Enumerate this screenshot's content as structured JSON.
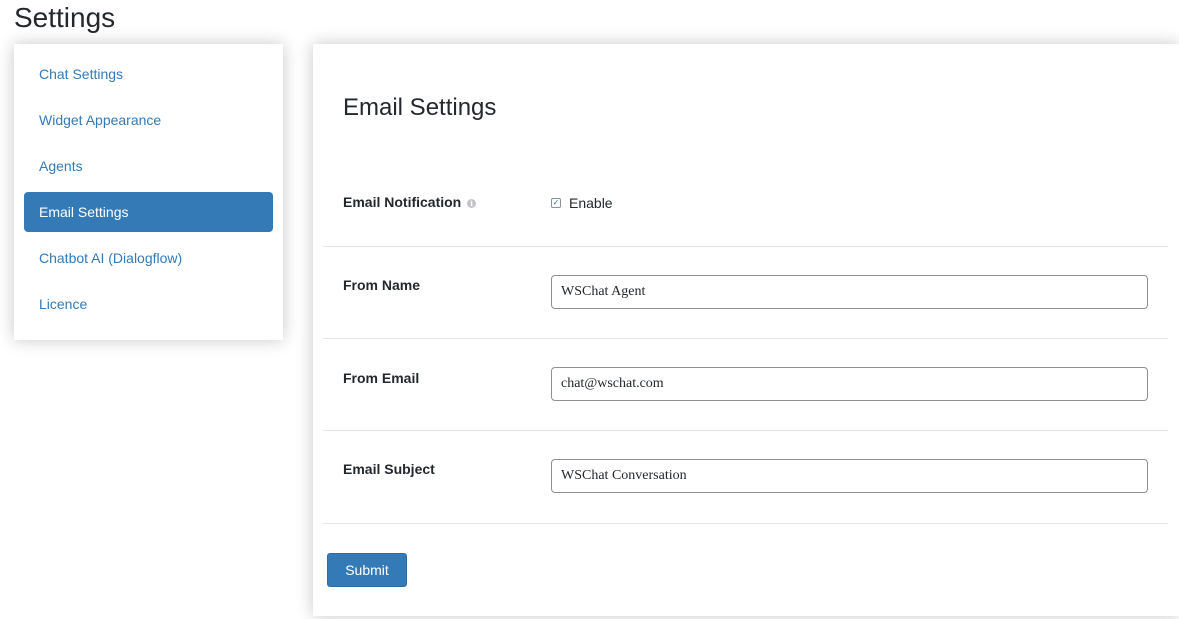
{
  "page": {
    "title": "Settings"
  },
  "sidebar": {
    "items": [
      {
        "label": "Chat Settings"
      },
      {
        "label": "Widget Appearance"
      },
      {
        "label": "Agents"
      },
      {
        "label": "Email Settings"
      },
      {
        "label": "Chatbot AI (Dialogflow)"
      },
      {
        "label": "Licence"
      }
    ],
    "active_item": "Email Settings"
  },
  "panel": {
    "title": "Email Settings",
    "email_notification": {
      "label": "Email Notification",
      "info_icon": "info-icon",
      "checkbox_label": "Enable",
      "checked": true
    },
    "from_name": {
      "label": "From Name",
      "value": "WSChat Agent"
    },
    "from_email": {
      "label": "From Email",
      "value": "chat@wschat.com"
    },
    "email_subject": {
      "label": "Email Subject",
      "value": "WSChat Conversation"
    },
    "submit_label": "Submit"
  },
  "colors": {
    "accent": "#337ab7",
    "text": "#23282d",
    "divider": "#e5e5e5"
  }
}
